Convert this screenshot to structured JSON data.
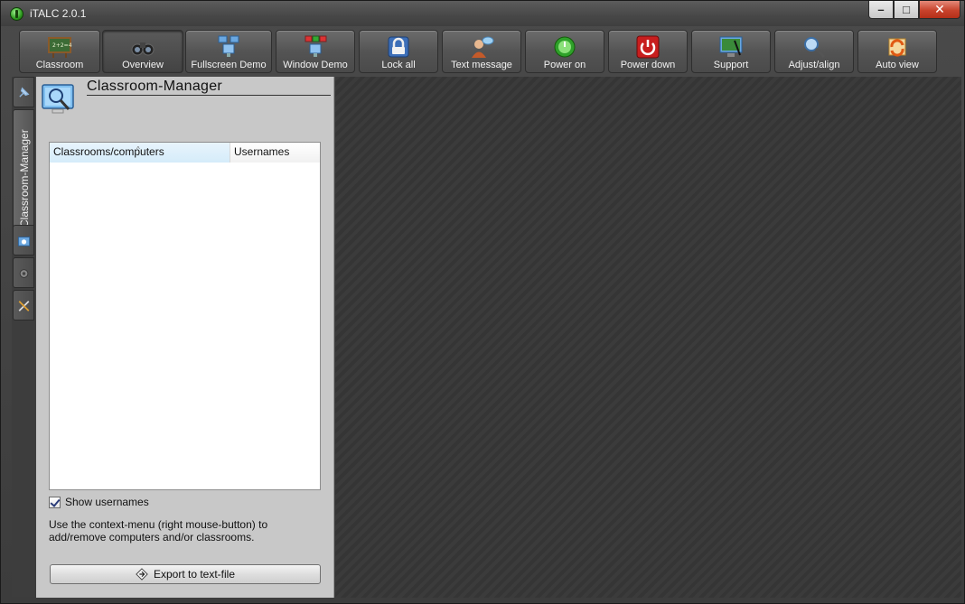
{
  "window": {
    "title": "iTALC 2.0.1"
  },
  "toolbar": {
    "buttons": [
      {
        "label": "Classroom",
        "icon": "chalkboard-icon"
      },
      {
        "label": "Overview",
        "icon": "binoculars-icon"
      },
      {
        "label": "Fullscreen Demo",
        "icon": "fullscreen-demo-icon"
      },
      {
        "label": "Window Demo",
        "icon": "window-demo-icon"
      },
      {
        "label": "Lock all",
        "icon": "lock-icon"
      },
      {
        "label": "Text message",
        "icon": "text-message-icon"
      },
      {
        "label": "Power on",
        "icon": "power-on-icon"
      },
      {
        "label": "Power down",
        "icon": "power-down-icon"
      },
      {
        "label": "Support",
        "icon": "support-icon"
      },
      {
        "label": "Adjust/align",
        "icon": "magnifier-icon"
      },
      {
        "label": "Auto view",
        "icon": "auto-view-icon"
      }
    ]
  },
  "sidebar": {
    "active_tab_label": "Classroom-Manager"
  },
  "panel": {
    "title": "Classroom-Manager",
    "columns": [
      "Classrooms/computers",
      "Usernames"
    ],
    "show_usernames_label": "Show usernames",
    "show_usernames_checked": true,
    "hint": "Use the context-menu (right mouse-button) to add/remove computers and/or classrooms.",
    "export_label": "Export to text-file"
  },
  "colors": {
    "power_on": "#2fa12a",
    "power_down": "#c81e1e",
    "accent": "#4a90d9"
  }
}
